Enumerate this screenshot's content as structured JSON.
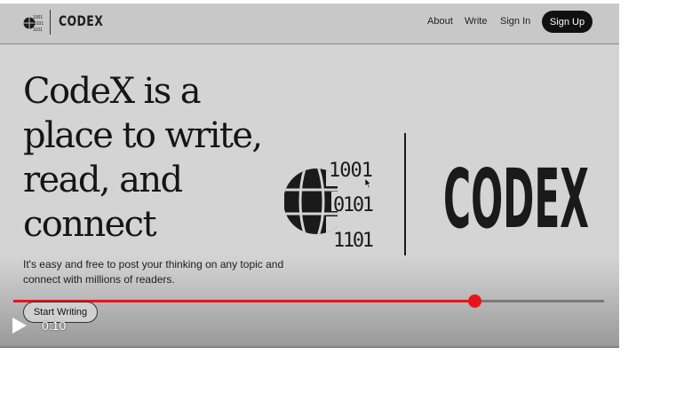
{
  "nav": {
    "logo_text": "CODEX",
    "logo_bits": [
      "1001",
      "0101",
      "1101"
    ],
    "links": [
      "About",
      "Write",
      "Sign In"
    ],
    "signup": "Sign Up"
  },
  "hero": {
    "title": "CodeX is a place to write, read, and connect",
    "subtitle": "It's easy and free to post your thinking on any topic and connect with millions of readers.",
    "cta": "Start Writing",
    "logo_bits": [
      "1001",
      "0101",
      "1101"
    ],
    "brand": "CODEX"
  },
  "player": {
    "time": "0:10",
    "progress_fraction": 0.78,
    "colors": {
      "progress": "#e8141c",
      "track": "#7a7a7a"
    }
  },
  "icons": [
    "globe-icon",
    "play-icon",
    "mouse-cursor-icon"
  ]
}
